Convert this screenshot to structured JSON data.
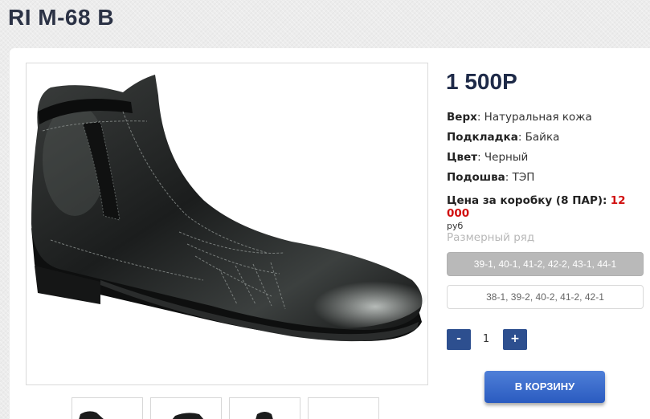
{
  "product": {
    "title": "RI M-68 B",
    "price": "1 500Р"
  },
  "specs": [
    {
      "label": "Верх",
      "value": ": Натуральная кожа"
    },
    {
      "label": "Подкладка",
      "value": ": Байка"
    },
    {
      "label": "Цвет",
      "value": ": Черный"
    },
    {
      "label": "Подошва",
      "value": ": ТЭП"
    }
  ],
  "box_price": {
    "label": "Цена за коробку (8 ПАР):",
    "value": "12 000",
    "currency": "руб"
  },
  "sizes": {
    "title": "Размерный ряд",
    "options": [
      {
        "label": "39-1, 40-1, 41-2, 42-2, 43-1, 44-1",
        "selected": true
      },
      {
        "label": "38-1, 39-2, 40-2, 41-2, 42-1",
        "selected": false
      }
    ]
  },
  "quantity": {
    "minus_label": "-",
    "value": "1",
    "plus_label": "+"
  },
  "cart": {
    "button_label": "В КОРЗИНУ"
  },
  "colors": {
    "accent": "#2d4f8f",
    "price_red": "#d10f0f",
    "selected_size_bg": "#b9b9b9"
  }
}
